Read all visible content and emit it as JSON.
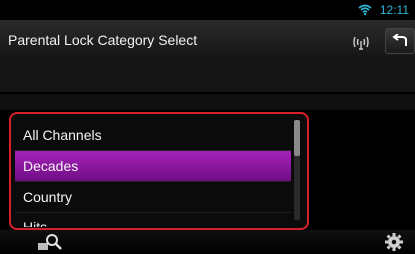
{
  "status_bar": {
    "time": "12:11",
    "wifi_icon": "wifi-icon"
  },
  "header": {
    "title": "Parental Lock Category Select",
    "antenna_icon": "antenna-icon",
    "back_icon": "back-arrow-icon"
  },
  "list": {
    "items": [
      {
        "label": "All Channels",
        "selected": false
      },
      {
        "label": "Decades",
        "selected": true
      },
      {
        "label": "Country",
        "selected": false
      },
      {
        "label": "Hits",
        "selected": false
      }
    ],
    "accent_color": "#8f1aa6",
    "highlight_border": "#d8202a"
  },
  "bottom_bar": {
    "search_icon": "search-icon",
    "settings_icon": "gear-icon"
  }
}
